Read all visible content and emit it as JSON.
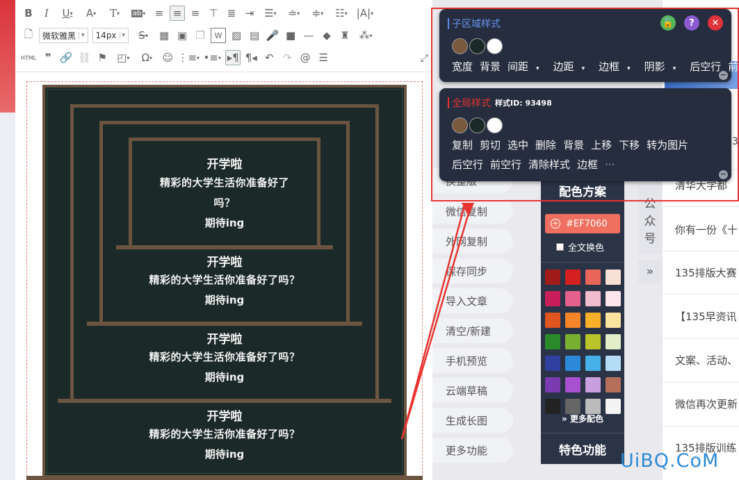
{
  "toolbar": {
    "font_family": "微软雅黑",
    "font_size": "14px",
    "html_label": "HTML"
  },
  "poster": {
    "blocks": [
      {
        "title": "开学啦",
        "line1": "精彩的大学生活你准备好了",
        "line2": "吗？",
        "end": "期待ing"
      },
      {
        "title": "开学啦",
        "line1": "精彩的大学生活你准备好了吗？",
        "end": "期待ing"
      },
      {
        "title": "开学啦",
        "line1": "精彩的大学生活你准备好了吗？",
        "end": "期待ing"
      },
      {
        "title": "开学啦",
        "line1": "精彩的大学生活你准备好了吗？",
        "end": "期待ing"
      }
    ],
    "colors": {
      "background": "#1b2a28",
      "frame": "#6b5541"
    }
  },
  "sub_panel": {
    "title": "子区域样式",
    "dots": [
      "#7a5a3e",
      "#1b2a28",
      "#ffffff"
    ],
    "actions": [
      {
        "label": "宽度",
        "caret": false
      },
      {
        "label": "背景",
        "caret": false
      },
      {
        "label": "间距",
        "caret": true
      },
      {
        "label": "边距",
        "caret": true
      },
      {
        "label": "边框",
        "caret": true
      },
      {
        "label": "阴影",
        "caret": true
      },
      {
        "label": "后空行",
        "caret": false
      },
      {
        "label": "前空行",
        "caret": false
      }
    ]
  },
  "global_panel": {
    "title": "全局样式",
    "style_id": "样式ID: 93498",
    "dots": [
      "#7a5a3e",
      "#1b2a28",
      "#ffffff"
    ],
    "actions_row1": [
      "复制",
      "剪切",
      "选中",
      "删除",
      "背景",
      "上移",
      "下移",
      "转为图片"
    ],
    "actions_row2": [
      "后空行",
      "前空行",
      "清除样式",
      "边框"
    ],
    "more": "···"
  },
  "side_menu": {
    "items": [
      "换整版",
      "微信复制",
      "外网复制",
      "保存同步",
      "导入文章",
      "清空/新建",
      "手机预览",
      "云端草稿",
      "生成长图",
      "更多功能"
    ]
  },
  "color_scheme": {
    "title": "配色方案",
    "current_hex": "#EF7060",
    "full_swap": "全文换色",
    "swatches": [
      "#a21b1b",
      "#d42020",
      "#e8665a",
      "#f9e0d6",
      "#c81f5a",
      "#e6608e",
      "#f2bccf",
      "#fbe6ee",
      "#e05420",
      "#f6842a",
      "#f7b02a",
      "#fbe4a0",
      "#2a8a2a",
      "#7ab030",
      "#b8c42a",
      "#e2eec8",
      "#3040a0",
      "#2c88d8",
      "#46b0e8",
      "#b4dcf6",
      "#7a3ab0",
      "#a850d0",
      "#c8a0e0",
      "#b4705a",
      "#222222",
      "#666666",
      "#bbbbbb",
      "#f4f4f4"
    ],
    "more_colors": "更多配色",
    "feature": "特色功能"
  },
  "public_account": {
    "label": "公众号",
    "expand": "»"
  },
  "news": {
    "items": [
      "清华大学都",
      "你有一份《十",
      "135排版大赛",
      "【135早资讯",
      "文案、活动、",
      "微信再次更新",
      "135排版训练"
    ],
    "extra": "3"
  },
  "watermark": "UiBQ.CoM"
}
